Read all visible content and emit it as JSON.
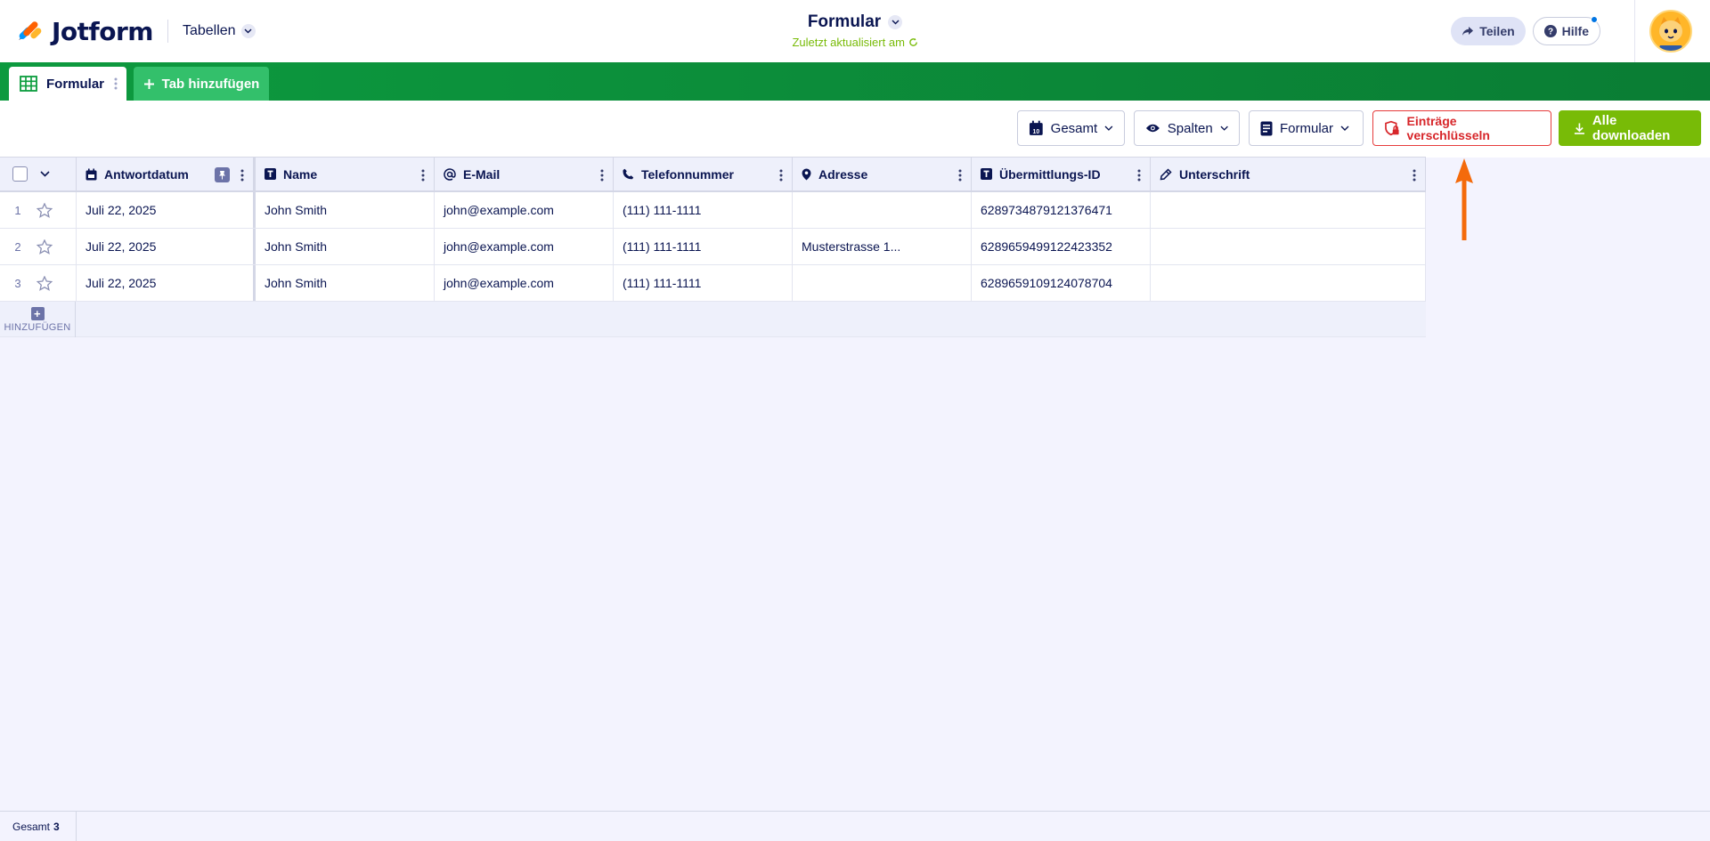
{
  "header": {
    "brand": "Jotform",
    "tables_label": "Tabellen",
    "form_title": "Formular",
    "last_updated": "Zuletzt aktualisiert am",
    "share_label": "Teilen",
    "help_label": "Hilfe"
  },
  "tabs": {
    "active_tab": "Formular",
    "add_tab": "Tab hinzufügen"
  },
  "toolbar": {
    "total_label": "Gesamt",
    "columns_label": "Spalten",
    "form_label": "Formular",
    "encrypt_label": "Einträge verschlüsseln",
    "download_label": "Alle downloaden"
  },
  "table": {
    "columns": [
      {
        "label": "Antwortdatum",
        "icon": "calendar-icon"
      },
      {
        "label": "Name",
        "icon": "text-field-icon"
      },
      {
        "label": "E-Mail",
        "icon": "at-icon"
      },
      {
        "label": "Telefonnummer",
        "icon": "phone-icon"
      },
      {
        "label": "Adresse",
        "icon": "location-pin-icon"
      },
      {
        "label": "Übermittlungs-ID",
        "icon": "text-field-icon"
      },
      {
        "label": "Unterschrift",
        "icon": "pen-icon"
      }
    ],
    "rows": [
      {
        "num": "1",
        "cells": [
          "Juli 22, 2025",
          "John Smith",
          "john@example.com",
          "(111) 111-1111",
          "",
          "6289734879121376471",
          ""
        ]
      },
      {
        "num": "2",
        "cells": [
          "Juli 22, 2025",
          "John Smith",
          "john@example.com",
          "(111) 111-1111",
          "Musterstrasse 1...",
          "6289659499122423352",
          ""
        ]
      },
      {
        "num": "3",
        "cells": [
          "Juli 22, 2025",
          "John Smith",
          "john@example.com",
          "(111) 111-1111",
          "",
          "6289659109124078704",
          ""
        ]
      }
    ],
    "add_label": "HINZUFÜGEN"
  },
  "footer": {
    "total_label": "Gesamt",
    "total_count": "3"
  },
  "colors": {
    "brand_navy": "#0a1551",
    "tab_green": "#0a7d34",
    "download_green": "#78bb07",
    "encrypt_red": "#d7262a",
    "annotation_arrow": "#f46a0b"
  }
}
